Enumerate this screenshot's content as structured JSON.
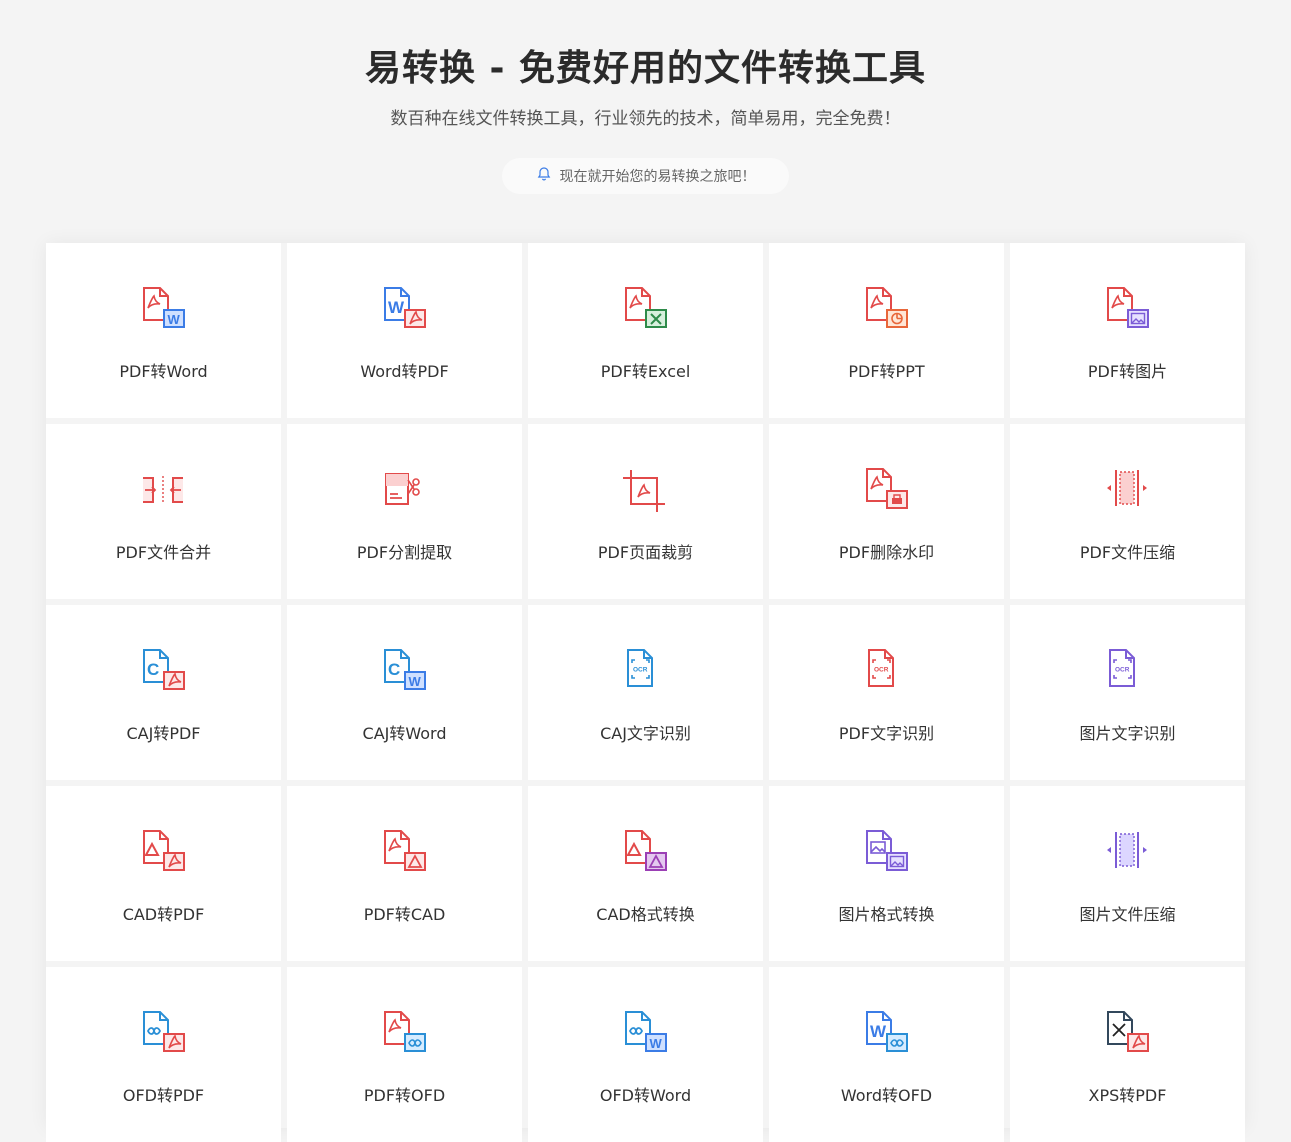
{
  "header": {
    "title": "易转换 - 免费好用的文件转换工具",
    "subtitle": "数百种在线文件转换工具，行业领先的技术，简单易用，完全免费！",
    "cta": "现在就开始您的易转换之旅吧！",
    "cta_icon": "bell-icon"
  },
  "colors": {
    "pdf": "#e24a4a",
    "word": "#3b7ce6",
    "excel": "#2e8b4a",
    "caj": "#2a8fd6",
    "purple": "#7b5cd6",
    "gray": "#555"
  },
  "tools": [
    {
      "label": "PDF转Word",
      "icon": "pdf-to-word-icon"
    },
    {
      "label": "Word转PDF",
      "icon": "word-to-pdf-icon"
    },
    {
      "label": "PDF转Excel",
      "icon": "pdf-to-excel-icon"
    },
    {
      "label": "PDF转PPT",
      "icon": "pdf-to-ppt-icon"
    },
    {
      "label": "PDF转图片",
      "icon": "pdf-to-image-icon"
    },
    {
      "label": "PDF文件合并",
      "icon": "pdf-merge-icon"
    },
    {
      "label": "PDF分割提取",
      "icon": "pdf-split-icon"
    },
    {
      "label": "PDF页面裁剪",
      "icon": "pdf-crop-icon"
    },
    {
      "label": "PDF删除水印",
      "icon": "pdf-remove-watermark-icon"
    },
    {
      "label": "PDF文件压缩",
      "icon": "pdf-compress-icon"
    },
    {
      "label": "CAJ转PDF",
      "icon": "caj-to-pdf-icon"
    },
    {
      "label": "CAJ转Word",
      "icon": "caj-to-word-icon"
    },
    {
      "label": "CAJ文字识别",
      "icon": "caj-ocr-icon"
    },
    {
      "label": "PDF文字识别",
      "icon": "pdf-ocr-icon"
    },
    {
      "label": "图片文字识别",
      "icon": "image-ocr-icon"
    },
    {
      "label": "CAD转PDF",
      "icon": "cad-to-pdf-icon"
    },
    {
      "label": "PDF转CAD",
      "icon": "pdf-to-cad-icon"
    },
    {
      "label": "CAD格式转换",
      "icon": "cad-convert-icon"
    },
    {
      "label": "图片格式转换",
      "icon": "image-convert-icon"
    },
    {
      "label": "图片文件压缩",
      "icon": "image-compress-icon"
    },
    {
      "label": "OFD转PDF",
      "icon": "ofd-to-pdf-icon"
    },
    {
      "label": "PDF转OFD",
      "icon": "pdf-to-ofd-icon"
    },
    {
      "label": "OFD转Word",
      "icon": "ofd-to-word-icon"
    },
    {
      "label": "Word转OFD",
      "icon": "word-to-ofd-icon"
    },
    {
      "label": "XPS转PDF",
      "icon": "xps-to-pdf-icon"
    }
  ]
}
